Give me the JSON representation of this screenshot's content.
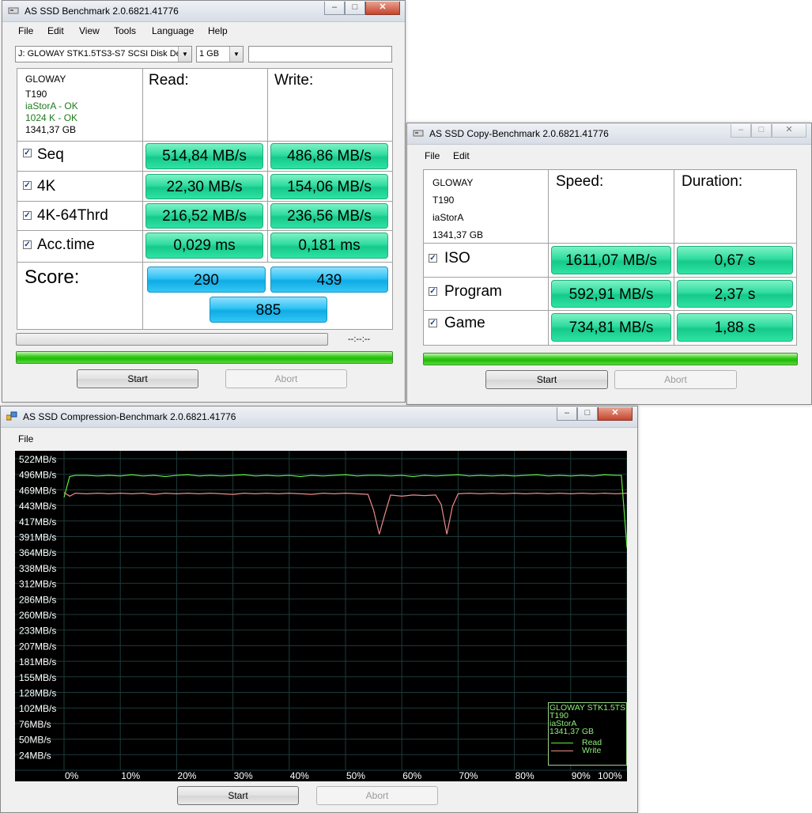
{
  "bench": {
    "title": "AS SSD Benchmark 2.0.6821.41776",
    "menu": [
      "File",
      "Edit",
      "View",
      "Tools",
      "Language",
      "Help"
    ],
    "drive_select": "J: GLOWAY STK1.5TS3-S7 SCSI Disk De",
    "size_select": "1 GB",
    "info": [
      "GLOWAY",
      "T190",
      "iaStorA - OK",
      "1024 K - OK",
      "1341,37 GB"
    ],
    "read_header": "Read:",
    "write_header": "Write:",
    "rows": [
      {
        "label": "Seq",
        "read": "514,84 MB/s",
        "write": "486,86 MB/s"
      },
      {
        "label": "4K",
        "read": "22,30 MB/s",
        "write": "154,06 MB/s"
      },
      {
        "label": "4K-64Thrd",
        "read": "216,52 MB/s",
        "write": "236,56 MB/s"
      },
      {
        "label": "Acc.time",
        "read": "0,029 ms",
        "write": "0,181 ms"
      }
    ],
    "score_label": "Score:",
    "score_read": "290",
    "score_write": "439",
    "score_total": "885",
    "elapsed": "--:--:--",
    "start": "Start",
    "abort": "Abort"
  },
  "copy": {
    "title": "AS SSD Copy-Benchmark 2.0.6821.41776",
    "menu": [
      "File",
      "Edit"
    ],
    "info": [
      "GLOWAY",
      "T190",
      "iaStorA",
      "1341,37 GB"
    ],
    "speed_header": "Speed:",
    "duration_header": "Duration:",
    "rows": [
      {
        "label": "ISO",
        "speed": "1611,07 MB/s",
        "duration": "0,67 s"
      },
      {
        "label": "Program",
        "speed": "592,91 MB/s",
        "duration": "2,37 s"
      },
      {
        "label": "Game",
        "speed": "734,81 MB/s",
        "duration": "1,88 s"
      }
    ],
    "start": "Start",
    "abort": "Abort"
  },
  "compression": {
    "title": "AS SSD Compression-Benchmark 2.0.6821.41776",
    "menu": [
      "File"
    ],
    "legend": {
      "lines": [
        "GLOWAY STK1.5TS",
        "T190",
        "iaStorA",
        "1341,37 GB"
      ],
      "read": "Read",
      "write": "Write"
    },
    "start": "Start",
    "abort": "Abort"
  },
  "chart_data": {
    "type": "line",
    "y_ticks": [
      "522MB/s",
      "496MB/s",
      "469MB/s",
      "443MB/s",
      "417MB/s",
      "391MB/s",
      "364MB/s",
      "338MB/s",
      "312MB/s",
      "286MB/s",
      "260MB/s",
      "233MB/s",
      "207MB/s",
      "181MB/s",
      "155MB/s",
      "128MB/s",
      "102MB/s",
      "76MB/s",
      "50MB/s",
      "24MB/s"
    ],
    "x_ticks": [
      "0%",
      "10%",
      "20%",
      "30%",
      "40%",
      "50%",
      "60%",
      "70%",
      "80%",
      "90%",
      "100%"
    ],
    "xlim": [
      0,
      100
    ],
    "ylim": [
      11,
      535
    ],
    "series": [
      {
        "name": "Read",
        "color": "#5ef03c",
        "x": [
          0,
          1,
          2,
          4,
          6,
          8,
          10,
          12,
          14,
          16,
          18,
          20,
          22,
          24,
          26,
          28,
          30,
          32,
          34,
          36,
          38,
          40,
          42,
          44,
          46,
          48,
          50,
          52,
          54,
          56,
          58,
          60,
          62,
          64,
          66,
          68,
          70,
          72,
          74,
          76,
          78,
          80,
          82,
          84,
          86,
          88,
          90,
          92,
          94,
          96,
          98,
          99,
          100
        ],
        "y": [
          470,
          505,
          507,
          507,
          506,
          507,
          506,
          508,
          506,
          507,
          505,
          507,
          508,
          506,
          507,
          506,
          507,
          508,
          506,
          507,
          506,
          507,
          505,
          507,
          506,
          507,
          508,
          506,
          507,
          507,
          506,
          507,
          505,
          507,
          506,
          507,
          508,
          506,
          507,
          506,
          507,
          506,
          507,
          508,
          506,
          507,
          506,
          507,
          506,
          508,
          507,
          507,
          385
        ]
      },
      {
        "name": "Write",
        "color": "#f08a8a",
        "x": [
          0,
          1,
          2,
          4,
          6,
          8,
          10,
          12,
          14,
          16,
          18,
          20,
          22,
          24,
          26,
          28,
          30,
          32,
          34,
          36,
          38,
          40,
          42,
          44,
          46,
          48,
          50,
          52,
          54,
          55,
          56,
          57,
          58,
          60,
          62,
          64,
          66,
          67,
          68,
          69,
          70,
          72,
          74,
          76,
          78,
          80,
          82,
          84,
          86,
          88,
          90,
          92,
          94,
          96,
          98,
          100
        ],
        "y": [
          478,
          472,
          477,
          476,
          477,
          476,
          477,
          476,
          477,
          475,
          477,
          476,
          477,
          476,
          477,
          476,
          475,
          477,
          476,
          477,
          476,
          477,
          476,
          475,
          477,
          476,
          477,
          476,
          475,
          448,
          408,
          442,
          474,
          472,
          474,
          473,
          474,
          458,
          408,
          455,
          476,
          477,
          476,
          477,
          476,
          477,
          476,
          477,
          476,
          477,
          476,
          477,
          476,
          477,
          476,
          477
        ]
      }
    ]
  }
}
